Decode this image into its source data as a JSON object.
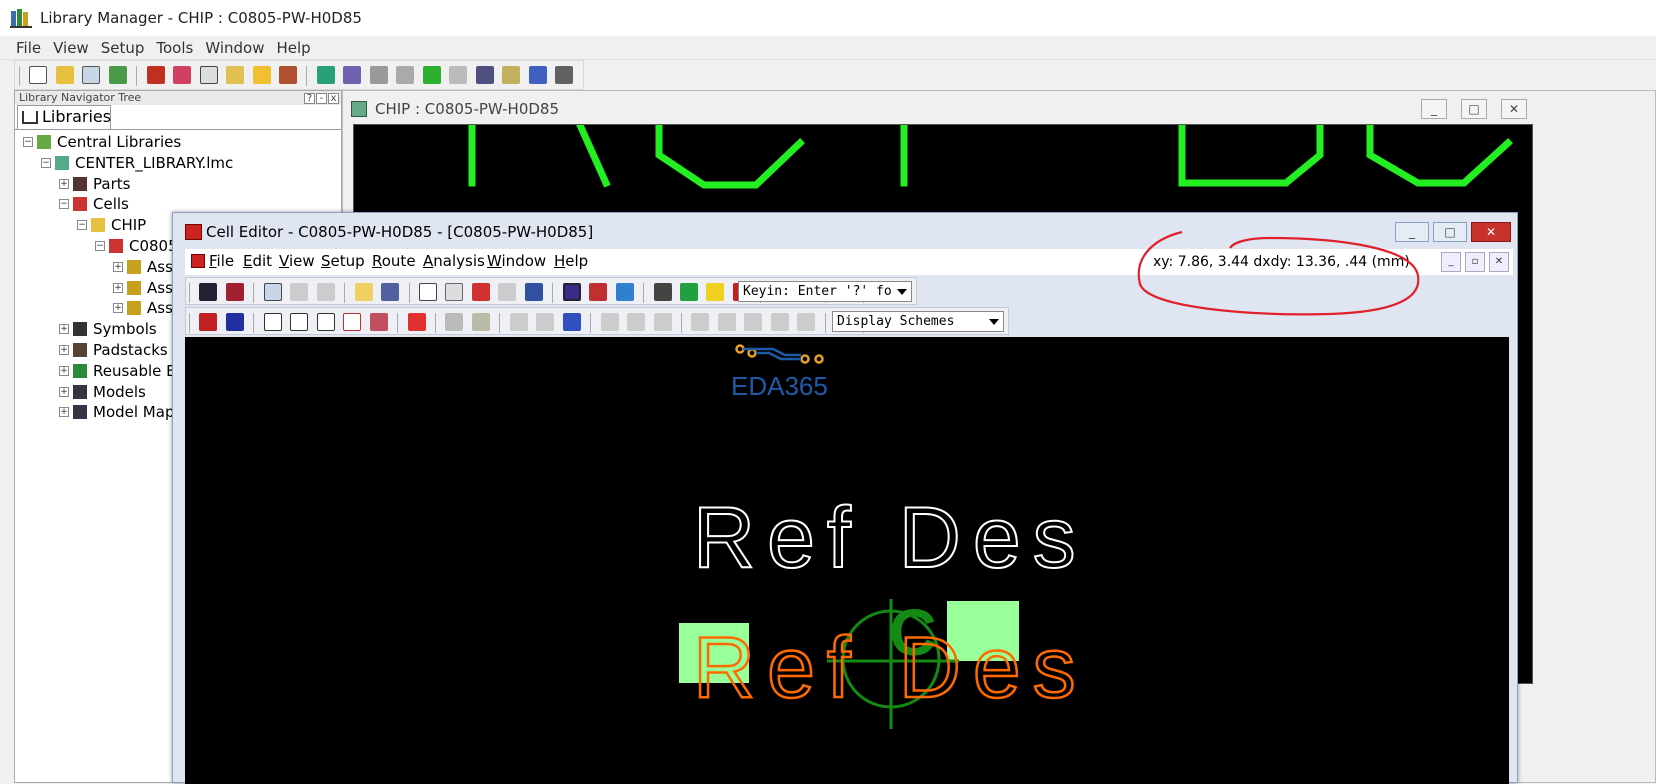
{
  "app": {
    "title": "Library Manager - CHIP : C0805-PW-H0D85",
    "menu": [
      "File",
      "View",
      "Setup",
      "Tools",
      "Window",
      "Help"
    ]
  },
  "navigator": {
    "title": "Library Navigator Tree",
    "title_buttons": [
      "?",
      "-",
      "x"
    ],
    "tab_label": "Libraries",
    "tree": [
      {
        "label": "Central Libraries",
        "level": 0,
        "expander": "−"
      },
      {
        "label": "CENTER_LIBRARY.lmc",
        "level": 1,
        "expander": "−"
      },
      {
        "label": "Parts",
        "level": 2,
        "expander": "+"
      },
      {
        "label": "Cells",
        "level": 2,
        "expander": "−"
      },
      {
        "label": "CHIP",
        "level": 3,
        "expander": "−"
      },
      {
        "label": "C0805",
        "level": 4,
        "expander": "−"
      },
      {
        "label": "Asso",
        "level": 5,
        "expander": "+"
      },
      {
        "label": "Asso",
        "level": 5,
        "expander": "+"
      },
      {
        "label": "Asso",
        "level": 5,
        "expander": "+"
      },
      {
        "label": "Symbols",
        "level": 2,
        "expander": "+"
      },
      {
        "label": "Padstacks",
        "level": 2,
        "expander": "+"
      },
      {
        "label": "Reusable Bl",
        "level": 2,
        "expander": "+"
      },
      {
        "label": "Models",
        "level": 2,
        "expander": "+"
      },
      {
        "label": "Model Map",
        "level": 2,
        "expander": "+"
      }
    ]
  },
  "chip_window": {
    "title": "CHIP : C0805-PW-H0D85"
  },
  "cell_editor": {
    "title": "Cell Editor - C0805-PW-H0D85 - [C0805-PW-H0D85]",
    "menu": [
      {
        "u": "F",
        "rest": "ile"
      },
      {
        "u": "E",
        "rest": "dit"
      },
      {
        "u": "V",
        "rest": "iew"
      },
      {
        "u": "S",
        "rest": "etup"
      },
      {
        "u": "R",
        "rest": "oute"
      },
      {
        "u": "A",
        "rest": "nalysis"
      },
      {
        "u": "W",
        "rest": "indow"
      },
      {
        "u": "H",
        "rest": "elp"
      }
    ],
    "coordinates": "xy: 7.86, 3.44   dxdy: 13.36, .44  (mm)",
    "keyin": "Keyin: Enter '?' fo",
    "display_schemes": "Display Schemes",
    "canvas": {
      "watermark": "EDA365",
      "silkscreen_text": "Ref Des",
      "assembly_text": "Ref Des",
      "origin_label": "C",
      "colors": {
        "background": "#000000",
        "silkscreen": "#ffffff",
        "assembly": "#ff6a00",
        "pads": "#99ff99",
        "origin": "#138a13",
        "watermark": "#1e5aa8",
        "watermark_trace": "#e8a020"
      }
    }
  },
  "colors": {
    "annotation": "#e0202a",
    "chip_outline": "#22ee22"
  }
}
